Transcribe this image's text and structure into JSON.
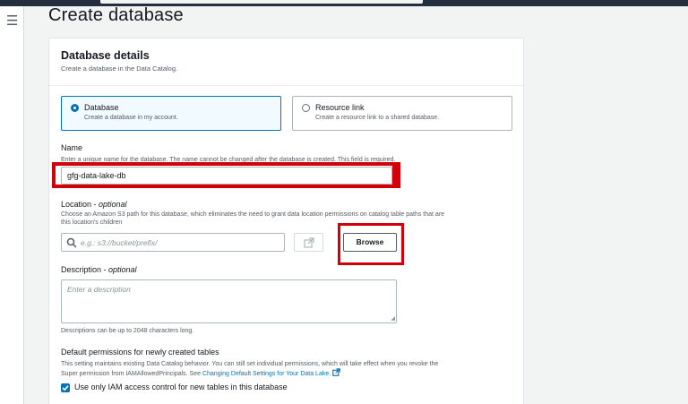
{
  "page": {
    "title": "Create database"
  },
  "details": {
    "title": "Database details",
    "description": "Create a database in the Data Catalog."
  },
  "options": [
    {
      "label": "Database",
      "description": "Create a database in my account.",
      "selected": true
    },
    {
      "label": "Resource link",
      "description": "Create a resource link to a shared database.",
      "selected": false
    }
  ],
  "name": {
    "label": "Name",
    "help": "Enter a unique name for the database. The name cannot be changed after the database is created. This field is required.",
    "value": "gfg-data-lake-db"
  },
  "location": {
    "label": "Location",
    "optional": "optional",
    "help_line1": "Choose an Amazon S3 path for this database, which eliminates the need to grant data location permissions on catalog table paths that are",
    "help_line2": "this location's children",
    "placeholder": "e.g.: s3://bucket/prefix/",
    "browse_label": "Browse"
  },
  "description": {
    "label": "Description",
    "optional": "optional",
    "placeholder": "Enter a description",
    "constraint": "Descriptions can be up to 2048 characters long."
  },
  "permissions": {
    "label": "Default permissions for newly created tables",
    "help_line1": "This setting maintains existing Data Catalog behavior. You can still set individual permissions, which will take effect when you revoke the",
    "help_line2_prefix": "Super permission from IAMAllowedPrincipals. See",
    "link_text": "Changing Default Settings for Your Data Lake.",
    "checkbox_label": "Use only IAM access control for new tables in this database",
    "checkbox_checked": true
  },
  "colors": {
    "accent": "#0073bb",
    "highlight": "#d1000b",
    "topbar": "#232f3e"
  }
}
